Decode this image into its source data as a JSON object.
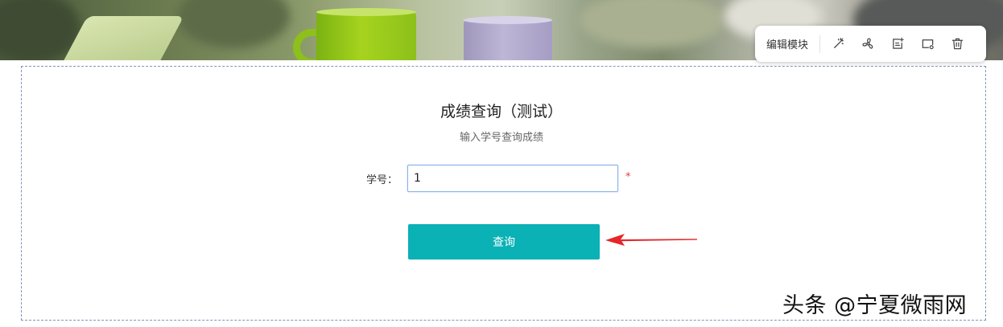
{
  "toolbar": {
    "label": "编辑模块",
    "icons": [
      "magic-wand-icon",
      "fan-icon",
      "insert-module-icon",
      "module-settings-icon",
      "trash-icon"
    ]
  },
  "form": {
    "title": "成绩查询（测试）",
    "subtitle": "输入学号查询成绩",
    "field_label": "学号：",
    "field_value": "1",
    "required_mark": "*",
    "submit_label": "查询"
  },
  "annotation": {
    "arrow_color": "#e5262a"
  },
  "watermark": "头条 @宁夏微雨网",
  "colors": {
    "accent": "#0ab1b5",
    "module_border": "#7d95b5",
    "input_focus": "#8ab1ec",
    "required": "#e04040"
  }
}
